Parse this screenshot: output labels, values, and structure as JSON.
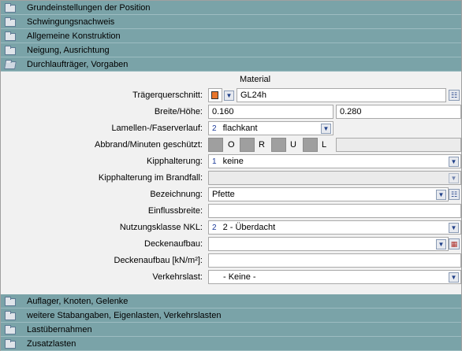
{
  "sections_top": [
    {
      "label": "Grundeinstellungen der Position",
      "icon": "folder-icon"
    },
    {
      "label": "Schwingungsnachweis",
      "icon": "folder-icon"
    },
    {
      "label": "Allgemeine Konstruktion",
      "icon": "folder-icon"
    },
    {
      "label": "Neigung, Ausrichtung",
      "icon": "folder-icon"
    },
    {
      "label": "Durchlaufträger, Vorgaben",
      "icon": "open-folder-icon"
    }
  ],
  "material_title": "Material",
  "fields": {
    "traegerquerschnitt": {
      "label": "Trägerquerschnitt:",
      "value": "GL24h",
      "swatch_color": "#e8752b"
    },
    "breite_hoehe": {
      "label": "Breite/Höhe:",
      "breite": "0.160",
      "hoehe": "0.280"
    },
    "lamellen": {
      "label": "Lamellen-/Faserverlauf:",
      "num": "2",
      "value": "flachkant"
    },
    "abbrand": {
      "label": "Abbrand/Minuten geschützt:",
      "o": "O",
      "r": "R",
      "u": "U",
      "l": "L"
    },
    "kipphalterung": {
      "label": "Kipphalterung:",
      "num": "1",
      "value": "keine"
    },
    "kipphalterung_brand": {
      "label": "Kipphalterung im Brandfall:",
      "value": ""
    },
    "bezeichnung": {
      "label": "Bezeichnung:",
      "value": "Pfette"
    },
    "einflussbreite": {
      "label": "Einflussbreite:",
      "value": ""
    },
    "nutzungsklasse": {
      "label": "Nutzungsklasse NKL:",
      "num": "2",
      "value": "2 - Überdacht"
    },
    "deckenaufbau": {
      "label": "Deckenaufbau:",
      "value": ""
    },
    "deckenaufbau_kn": {
      "label": "Deckenaufbau [kN/m²]:",
      "value": ""
    },
    "verkehrslast": {
      "label": "Verkehrslast:",
      "value": "- Keine -"
    }
  },
  "sections_bottom": [
    {
      "label": "Auflager, Knoten, Gelenke",
      "icon": "folder-icon"
    },
    {
      "label": "weitere Stabangaben, Eigenlasten, Verkehrslasten",
      "icon": "folder-icon"
    },
    {
      "label": "Lastübernahmen",
      "icon": "folder-icon"
    },
    {
      "label": "Zusatzlasten",
      "icon": "folder-icon"
    }
  ]
}
